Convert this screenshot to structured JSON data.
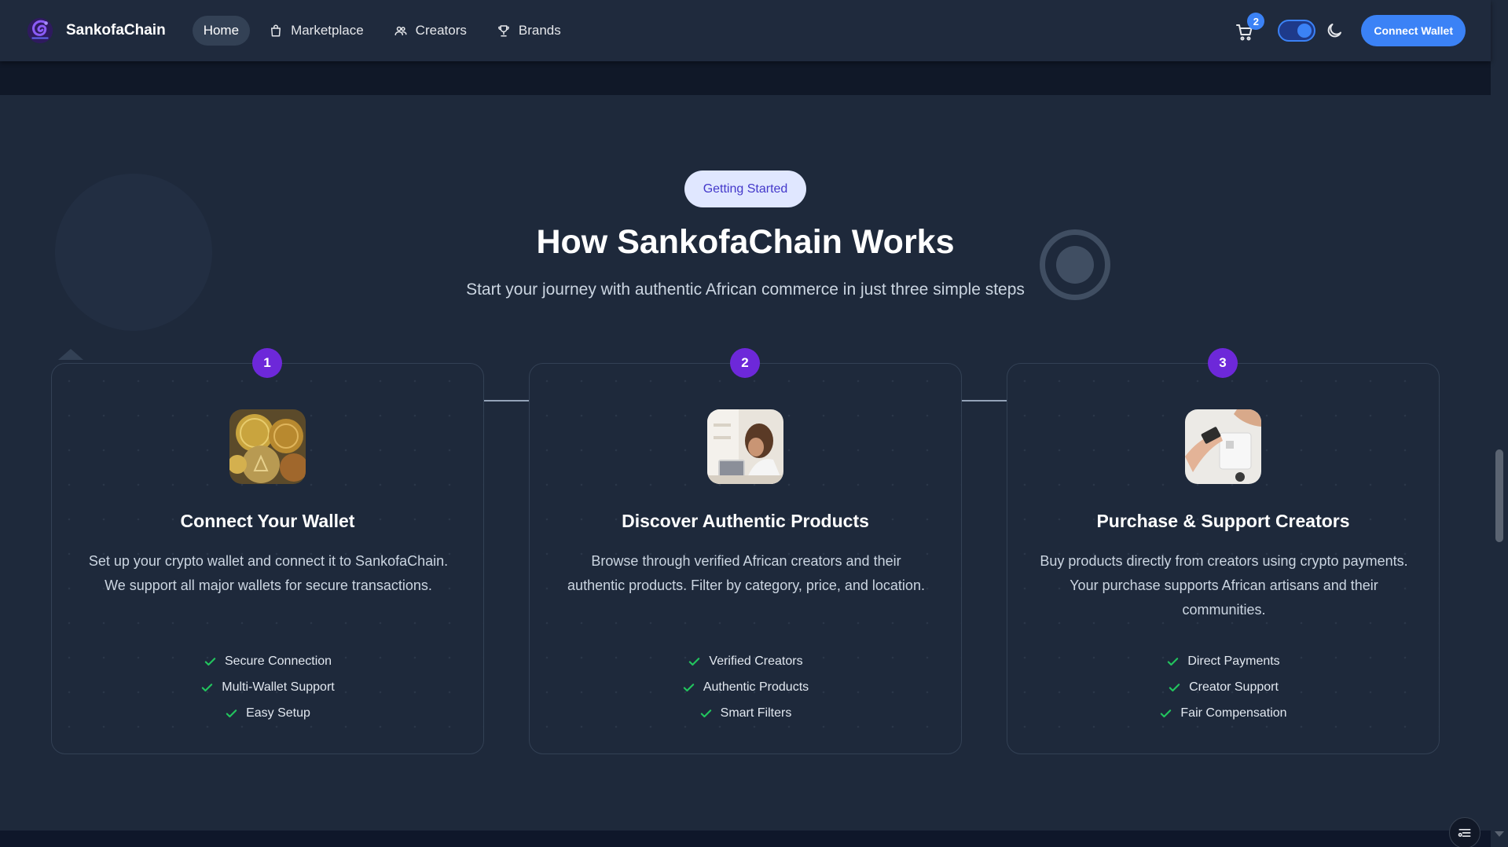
{
  "nav": {
    "brand": "SankofaChain",
    "links": [
      {
        "label": "Home",
        "icon": "home"
      },
      {
        "label": "Marketplace",
        "icon": "shopping-bag-icon"
      },
      {
        "label": "Creators",
        "icon": "users-icon"
      },
      {
        "label": "Brands",
        "icon": "trophy-icon"
      }
    ],
    "cart_count": "2",
    "theme": "dark",
    "connect_label": "Connect Wallet"
  },
  "section": {
    "pill": "Getting Started",
    "title": "How SankofaChain Works",
    "subtitle": "Start your journey with authentic African commerce in just three simple steps",
    "steps": [
      {
        "number": "1",
        "title": "Connect Your Wallet",
        "image": "gold-coins-photo",
        "description": "Set up your crypto wallet and connect it to SankofaChain. We support all major wallets for secure transactions.",
        "features": [
          "Secure Connection",
          "Multi-Wallet Support",
          "Easy Setup"
        ]
      },
      {
        "number": "2",
        "title": "Discover Authentic Products",
        "image": "woman-browsing-photo",
        "description": "Browse through verified African creators and their authentic products. Filter by category, price, and location.",
        "features": [
          "Verified Creators",
          "Authentic Products",
          "Smart Filters"
        ]
      },
      {
        "number": "3",
        "title": "Purchase & Support Creators",
        "image": "card-payment-photo",
        "description": "Buy products directly from creators using crypto payments. Your purchase supports African artisans and their communities.",
        "features": [
          "Direct Payments",
          "Creator Support",
          "Fair Compensation"
        ]
      }
    ]
  },
  "colors": {
    "accent": "#3b82f6",
    "step_badge": "#6d28d9",
    "check": "#22c55e",
    "background": "#1e293b"
  }
}
